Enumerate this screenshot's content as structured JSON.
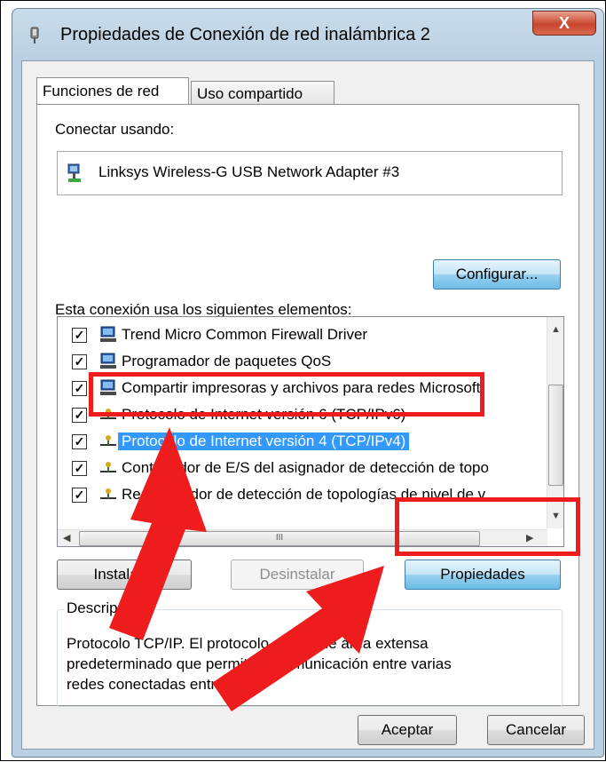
{
  "window": {
    "title": "Propiedades de Conexión de red inalámbrica 2",
    "close_label": "X"
  },
  "tabs": [
    {
      "label": "Funciones de red",
      "active": true
    },
    {
      "label": "Uso compartido",
      "active": false
    }
  ],
  "connect_using": {
    "label": "Conectar usando:",
    "adapter": "Linksys Wireless-G USB Network Adapter #3",
    "configure_button": "Configurar..."
  },
  "components": {
    "label": "Esta conexión usa los siguientes elementos:",
    "items": [
      {
        "label": "Trend Micro Common Firewall Driver",
        "checked": true,
        "icon": "network-client-icon"
      },
      {
        "label": "Programador de paquetes QoS",
        "checked": true,
        "icon": "network-client-icon"
      },
      {
        "label": "Compartir impresoras y archivos para redes Microsoft",
        "checked": true,
        "icon": "network-client-icon"
      },
      {
        "label": "Protocolo de Internet versión 6 (TCP/IPv6)",
        "checked": true,
        "icon": "protocol-icon"
      },
      {
        "label": "Protocolo de Internet versión 4 (TCP/IPv4)",
        "checked": true,
        "icon": "protocol-icon",
        "selected": true
      },
      {
        "label": "Controlador de E/S del asignador de detección de topo",
        "checked": true,
        "icon": "protocol-icon"
      },
      {
        "label": "Respondedor de detección de topologías de nivel de v",
        "checked": true,
        "icon": "protocol-icon"
      }
    ],
    "hscroll_grip": "III"
  },
  "buttons": {
    "install": "Instalar...",
    "uninstall": "Desinstalar",
    "properties": "Propiedades",
    "ok": "Aceptar",
    "cancel": "Cancelar"
  },
  "description": {
    "legend": "Descripción",
    "text": "Protocolo TCP/IP. El protocolo de red de área extensa predeterminado que permite la comunicación entre varias redes conectadas entre sí."
  },
  "colors": {
    "highlight": "#3399ff",
    "annotation_red": "#ee1c1c"
  }
}
